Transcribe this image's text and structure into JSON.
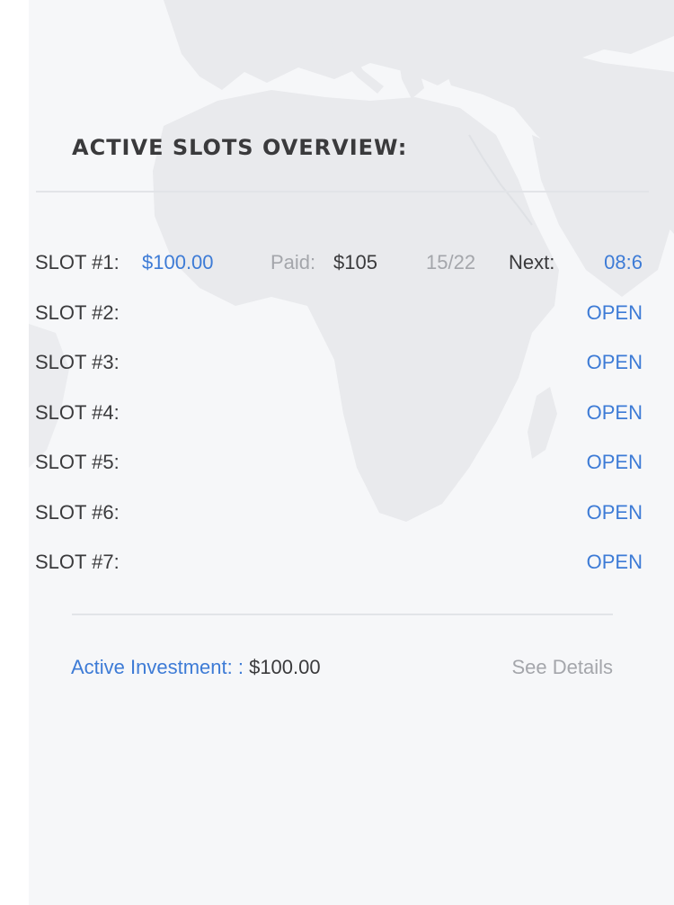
{
  "overview": {
    "title": "ACTIVE SLOTS OVERVIEW:"
  },
  "active_slot": {
    "label": "SLOT #1:",
    "amount": "$100.00",
    "paid_label": "Paid:",
    "paid_value": "$105",
    "progress": "15/22",
    "next_label": "Next:",
    "next_value": "08:6"
  },
  "open_slots": [
    {
      "label": "SLOT #2:",
      "status": "OPEN"
    },
    {
      "label": "SLOT #3:",
      "status": "OPEN"
    },
    {
      "label": "SLOT #4:",
      "status": "OPEN"
    },
    {
      "label": "SLOT #5:",
      "status": "OPEN"
    },
    {
      "label": "SLOT #6:",
      "status": "OPEN"
    },
    {
      "label": "SLOT #7:",
      "status": "OPEN"
    }
  ],
  "footer": {
    "investment_label": "Active Investment: :",
    "investment_value": "$100.00",
    "details_link": "See Details"
  },
  "colors": {
    "accent": "#3d7bd6",
    "text": "#3a3a3c",
    "muted": "#a4a6ab",
    "background": "#f6f7f9",
    "map": "#e8e9ec"
  },
  "background_image": "world-map-europe-africa"
}
